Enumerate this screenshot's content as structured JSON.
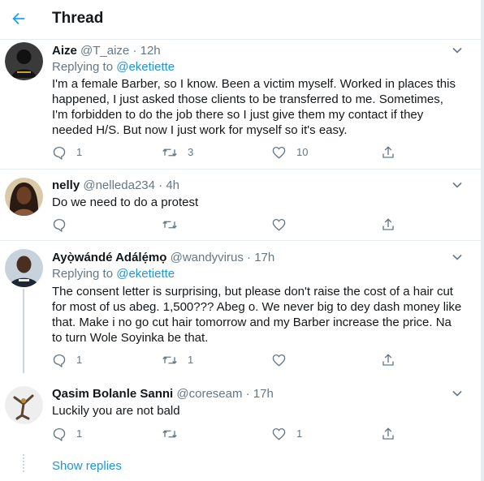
{
  "header": {
    "title": "Thread"
  },
  "tweets": [
    {
      "name": "Aize",
      "handle": "@T_aize",
      "dot": "·",
      "time": "12h",
      "replying_prefix": "Replying to",
      "replying_to": "@eketiette",
      "text": "I'm a female Barber, so I know. Been a victim myself. Worked in places this happened, I just asked those clients to be transferred to me. Sometimes, I'm forbidden to do the job there so I just give them my contact if they needed H/S. But now I just work for myself so it's easy.",
      "counts": {
        "replies": "1",
        "retweets": "3",
        "likes": "10"
      }
    },
    {
      "name": "nelly",
      "handle": "@nelleda234",
      "dot": "·",
      "time": "4h",
      "text": "Do we need to do a protest",
      "counts": {
        "replies": "",
        "retweets": "",
        "likes": ""
      }
    },
    {
      "name": "Ayọ̀wándé Adálẹ́mọ",
      "handle": "@wandyvirus",
      "dot": "·",
      "time": "17h",
      "replying_prefix": "Replying to",
      "replying_to": "@eketiette",
      "text": "The consent letter is surprising, but please don't raise the cost of a hair cut for most of us abeg. 1,500??? Abeg o. We never big to dey dash money like that. Make i no go cut hair tomorrow and my Barber increase the price. Na to turn Wole Soyinka be that.",
      "counts": {
        "replies": "1",
        "retweets": "1",
        "likes": ""
      }
    },
    {
      "name": "Qasim Bolanle Sanni",
      "handle": "@coreseam",
      "dot": "·",
      "time": "17h",
      "text": "Luckily you are not bald",
      "counts": {
        "replies": "1",
        "retweets": "",
        "likes": "1"
      }
    }
  ],
  "show_replies": "Show replies",
  "colors": {
    "accent": "#1b95e0",
    "muted": "#657786",
    "border": "#e6ecf0"
  }
}
